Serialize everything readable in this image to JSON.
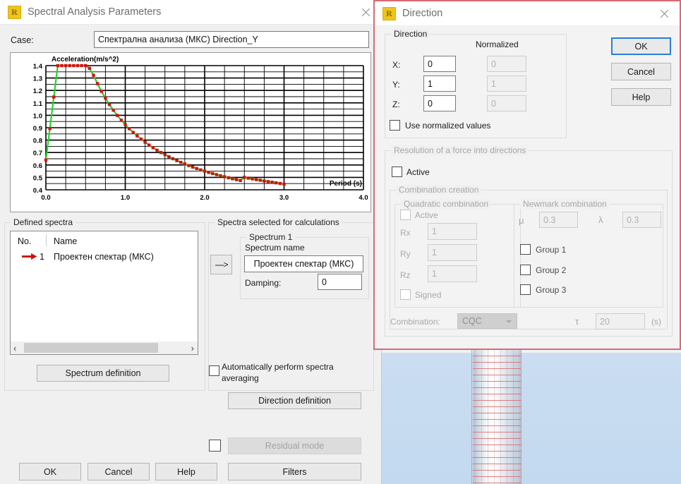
{
  "viewport": {
    "model_name": "tower-mesh"
  },
  "main_dialog": {
    "title": "Spectral Analysis Parameters",
    "icon": "R",
    "close_icon": "close-icon",
    "case_label": "Case:",
    "case_value": "Спектрална анализа (МКС) Direction_Y",
    "defined_spectra": {
      "group_label": "Defined spectra",
      "columns": [
        "No.",
        "Name"
      ],
      "rows": [
        {
          "no": "1",
          "name": "Проектен спектар (МКС)",
          "selected": true
        }
      ],
      "spectrum_definition_button": "Spectrum definition",
      "scroll_left_icon": "‹",
      "scroll_right_icon": "›"
    },
    "selected_spectra": {
      "group_label": "Spectra selected for calculations",
      "transfer_button": "---->",
      "spectrum_group_label": "Spectrum 1",
      "spectrum_name_label": "Spectrum name",
      "spectrum_name_value": "Проектен спектар (МКС)",
      "damping_label": "Damping:",
      "damping_value": "0",
      "auto_average_label": "Automatically perform spectra averaging",
      "auto_average_checked": false
    },
    "direction_definition_button": "Direction definition",
    "residual_mode_button": "Residual mode",
    "residual_mode_checked": false,
    "buttons": {
      "ok": "OK",
      "cancel": "Cancel",
      "help": "Help",
      "filters": "Filters"
    }
  },
  "direction_dialog": {
    "title": "Direction",
    "icon": "R",
    "close_icon": "close-icon",
    "direction_group": {
      "label": "Direction",
      "normalized_header": "Normalized",
      "axes": [
        {
          "label": "X:",
          "value": "0",
          "normalized": "0"
        },
        {
          "label": "Y:",
          "value": "1",
          "normalized": "1"
        },
        {
          "label": "Z:",
          "value": "0",
          "normalized": "0"
        }
      ],
      "use_normalized_label": "Use normalized values",
      "use_normalized_checked": false
    },
    "resolution_group": {
      "label": "Resolution of a force into directions",
      "active_label": "Active",
      "active_checked": false,
      "combination_creation_label": "Combination creation",
      "quadratic": {
        "label": "Quadratic combination",
        "active_label": "Active",
        "active_checked": false,
        "fields": [
          {
            "label": "Rx",
            "value": "1"
          },
          {
            "label": "Ry",
            "value": "1"
          },
          {
            "label": "Rz",
            "value": "1"
          }
        ],
        "signed_label": "Signed",
        "signed_checked": false
      },
      "newmark": {
        "label": "Newmark combination",
        "mu_symbol": "μ",
        "mu_value": "0.3",
        "lambda_symbol": "λ",
        "lambda_value": "0.3",
        "groups": [
          {
            "label": "Group 1",
            "checked": false
          },
          {
            "label": "Group 2",
            "checked": false
          },
          {
            "label": "Group 3",
            "checked": false
          }
        ]
      },
      "combination_label": "Combination:",
      "combination_value": "CQC",
      "combination_options": [
        "CQC"
      ],
      "tau_symbol": "τ",
      "tau_value": "20",
      "tau_unit": "(s)"
    },
    "buttons": {
      "ok": "OK",
      "cancel": "Cancel",
      "help": "Help"
    },
    "accent_color": "#2a7fd4"
  },
  "chart_data": {
    "type": "line",
    "title": "Acceleration(m/s^2)",
    "xlabel": "Period (s)",
    "ylabel": "Acceleration(m/s^2)",
    "xlim": [
      0.0,
      4.0
    ],
    "ylim": [
      0.4,
      1.4
    ],
    "xticks": [
      "0.0",
      "1.0",
      "2.0",
      "3.0",
      "4.0"
    ],
    "yticks": [
      "0.4",
      "0.5",
      "0.6",
      "0.7",
      "0.8",
      "0.9",
      "1.0",
      "1.1",
      "1.2",
      "1.3",
      "1.4"
    ],
    "grid": true,
    "grid_minor_x": 0.25,
    "grid_minor_y": 0.05,
    "legend": "none",
    "series": [
      {
        "name": "Проектен спектар (МКС)",
        "line_color": "#22d52b",
        "marker_color": "#d41111",
        "x": [
          0.0,
          0.05,
          0.1,
          0.15,
          0.2,
          0.25,
          0.3,
          0.35,
          0.4,
          0.45,
          0.5,
          0.55,
          0.6,
          0.65,
          0.7,
          0.75,
          0.8,
          0.85,
          0.9,
          0.95,
          1.0,
          1.05,
          1.1,
          1.15,
          1.2,
          1.25,
          1.3,
          1.35,
          1.4,
          1.45,
          1.5,
          1.55,
          1.6,
          1.65,
          1.7,
          1.75,
          1.8,
          1.85,
          1.9,
          1.95,
          2.0,
          2.05,
          2.1,
          2.15,
          2.2,
          2.25,
          2.3,
          2.35,
          2.4,
          2.45,
          2.5,
          2.55,
          2.6,
          2.65,
          2.7,
          2.75,
          2.8,
          2.85,
          2.9,
          2.95,
          3.0
        ],
        "y": [
          0.64,
          0.893,
          1.147,
          1.4,
          1.4,
          1.4,
          1.4,
          1.4,
          1.4,
          1.4,
          1.4,
          1.378,
          1.322,
          1.255,
          1.193,
          1.138,
          1.087,
          1.041,
          0.999,
          0.96,
          0.925,
          0.892,
          0.862,
          0.834,
          0.808,
          0.783,
          0.76,
          0.739,
          0.719,
          0.7,
          0.683,
          0.666,
          0.65,
          0.635,
          0.621,
          0.608,
          0.595,
          0.583,
          0.571,
          0.56,
          0.55,
          0.54,
          0.531,
          0.522,
          0.513,
          0.505,
          0.497,
          0.489,
          0.482,
          0.475,
          0.5,
          0.494,
          0.488,
          0.482,
          0.477,
          0.471,
          0.466,
          0.461,
          0.456,
          0.451,
          0.446
        ]
      }
    ]
  }
}
